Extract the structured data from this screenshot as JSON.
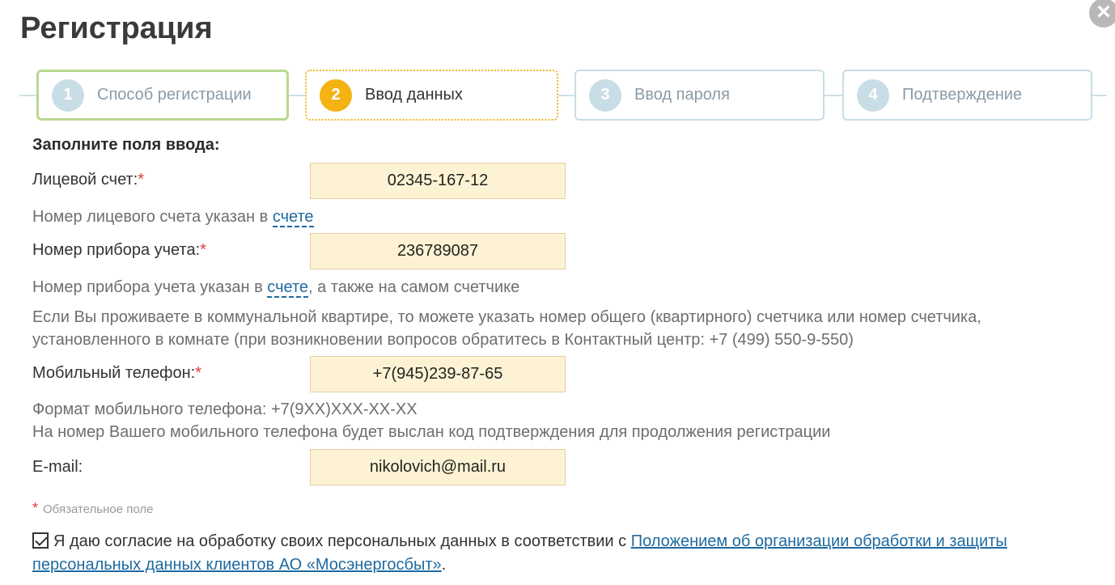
{
  "title": "Регистрация",
  "close_icon": "×",
  "steps": [
    {
      "num": "1",
      "label": "Способ регистрации",
      "state": "done"
    },
    {
      "num": "2",
      "label": "Ввод данных",
      "state": "active"
    },
    {
      "num": "3",
      "label": "Ввод пароля",
      "state": "pending"
    },
    {
      "num": "4",
      "label": "Подтверждение",
      "state": "pending"
    }
  ],
  "form": {
    "heading": "Заполните поля ввода:",
    "required_mark": "*",
    "account": {
      "label": "Лицевой счет:",
      "value": "02345-167-12",
      "hint_prefix": "Номер лицевого счета указан в ",
      "hint_link": "счете"
    },
    "meter": {
      "label": "Номер прибора учета:",
      "value": "236789087",
      "hint_prefix": "Номер прибора учета указан в ",
      "hint_link": "счете",
      "hint_suffix": ", а также на самом счетчике",
      "hint_line2": "Если Вы проживаете в коммунальной квартире, то можете указать номер общего (квартирного) счетчика или номер счетчика,",
      "hint_line3": "установленного в комнате (при возникновении вопросов обратитесь в Контактный центр: +7 (499) 550-9-550)"
    },
    "phone": {
      "label": "Мобильный телефон:",
      "value": "+7(945)239-87-65",
      "hint_line1": "Формат мобильного телефона: +7(9XX)XXX-XX-XX",
      "hint_line2": "На номер Вашего мобильного телефона будет выслан код подтверждения для продолжения регистрации"
    },
    "email": {
      "label": "E-mail:",
      "value": "nikolovich@mail.ru"
    },
    "required_note": "Обязательное поле",
    "consent": {
      "checked": true,
      "text": "Я даю согласие на обработку своих персональных данных в соответствии с ",
      "link": "Положением об организации обработки и защиты персональных данных клиентов АО «Мосэнергосбыт»",
      "end": "."
    }
  },
  "colors": {
    "step_done_border": "#b9d98f",
    "step_active": "#f4b213",
    "step_pending": "#c9dde6",
    "input_bg": "#fdf3d4",
    "link": "#1f6aa0",
    "required": "#e53935"
  }
}
